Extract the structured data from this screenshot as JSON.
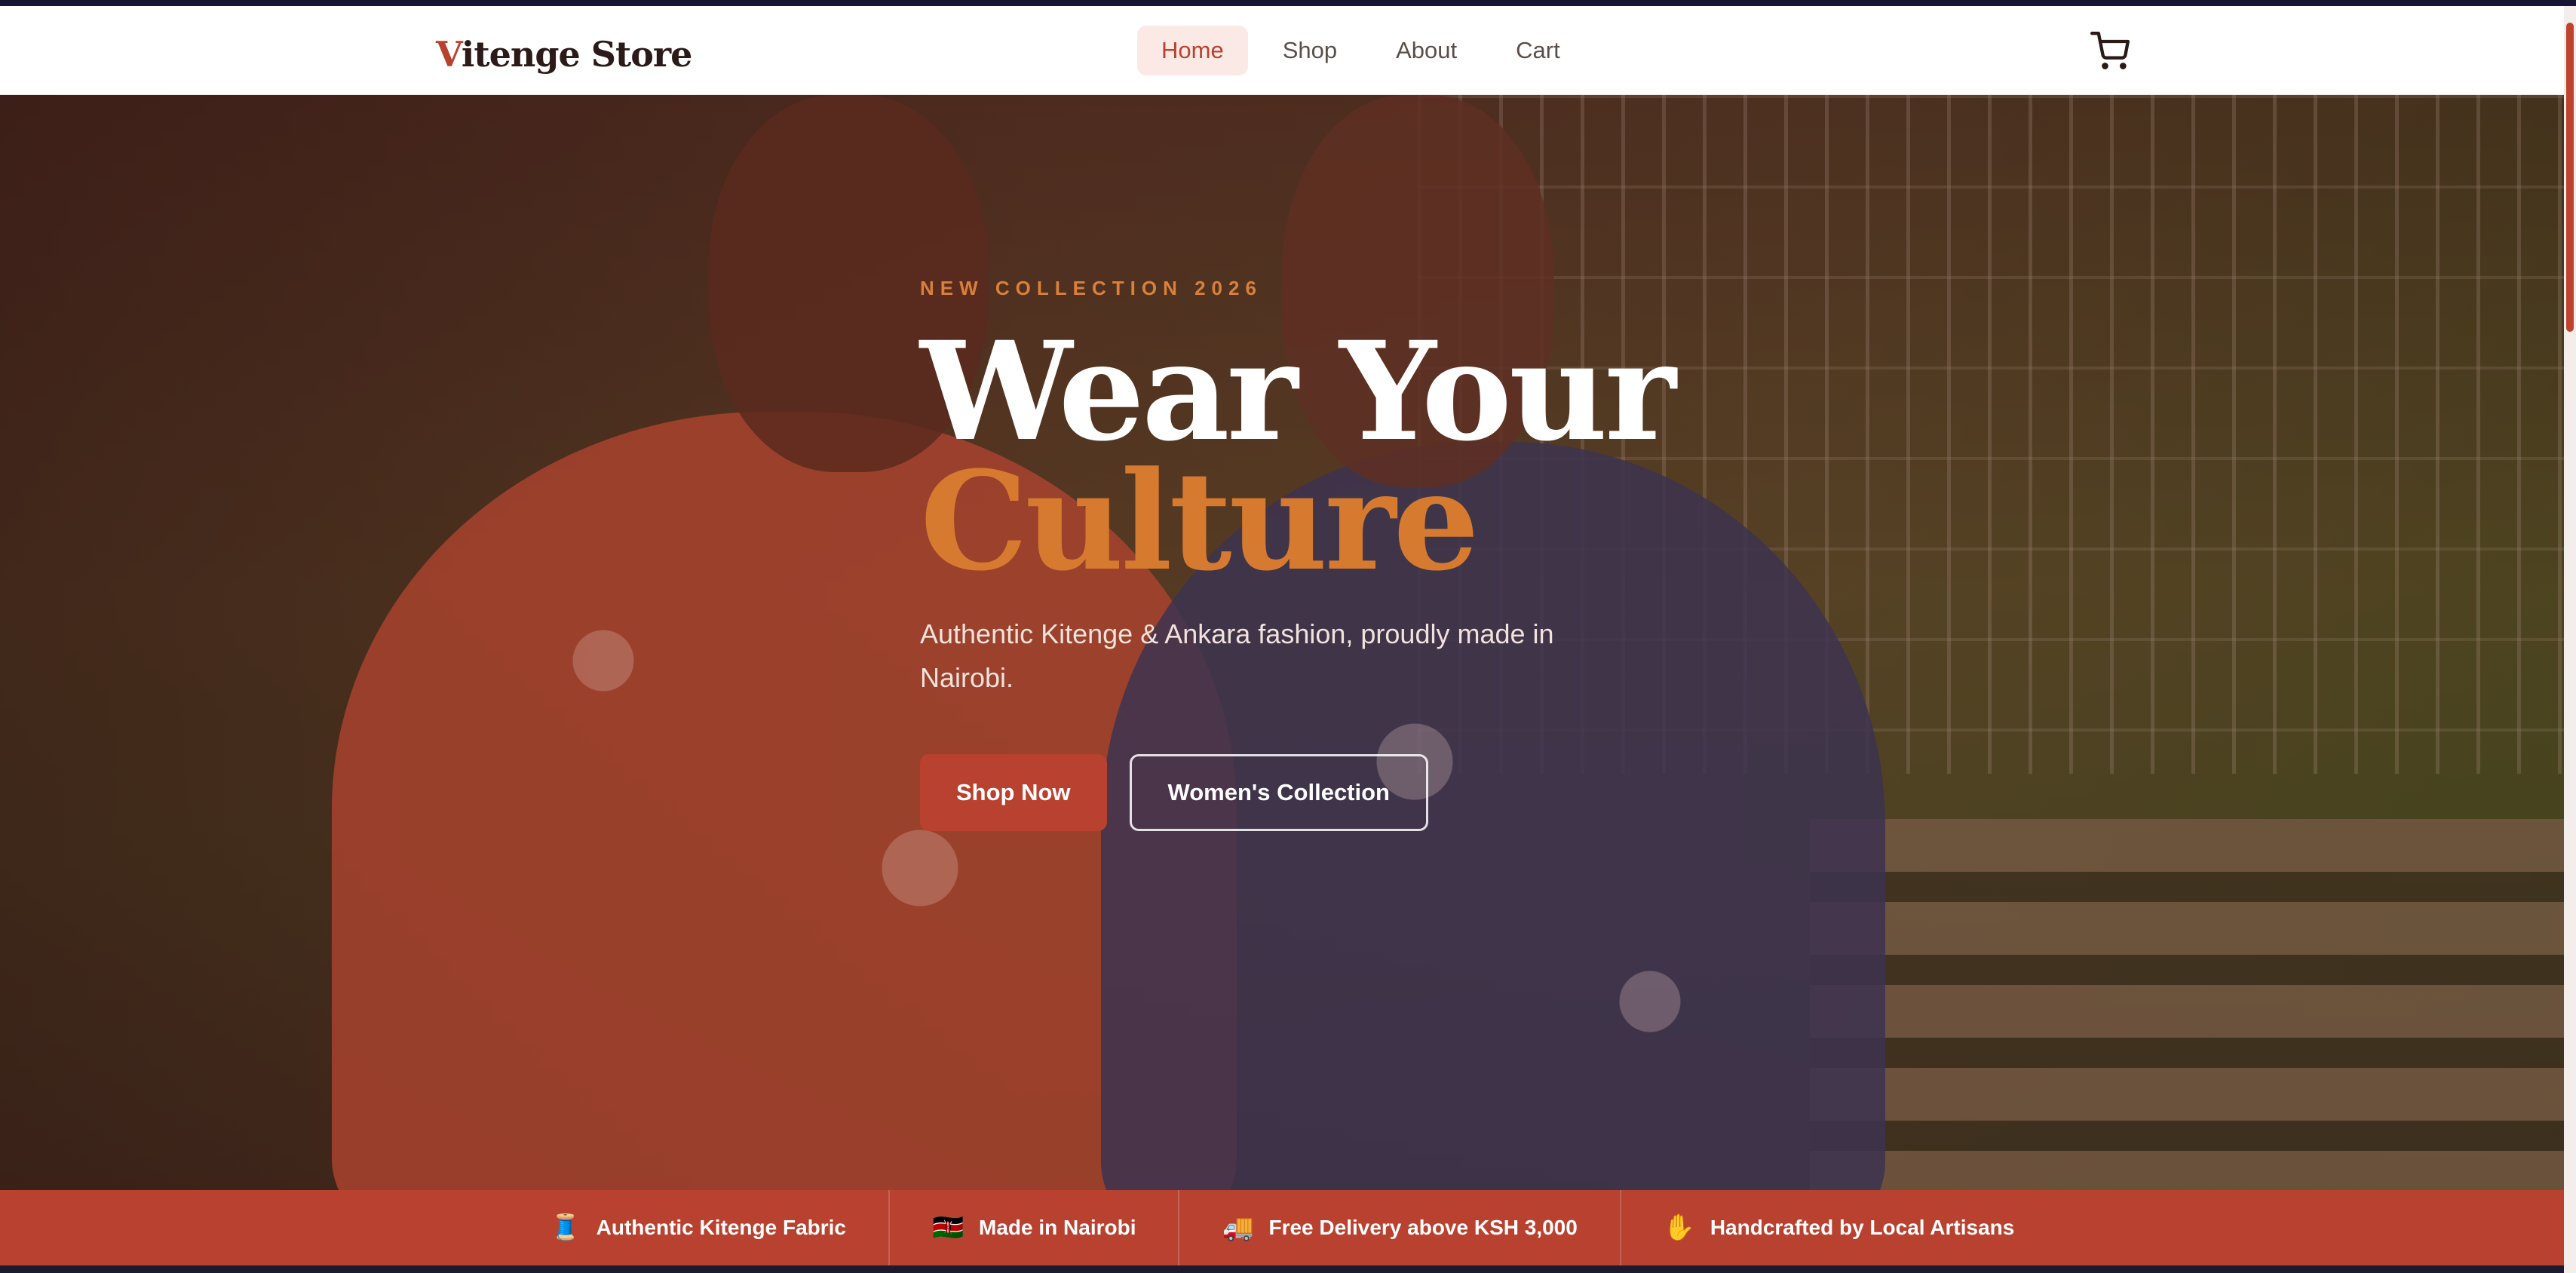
{
  "brand": {
    "initial": "V",
    "rest": "itenge Store"
  },
  "nav": {
    "items": [
      {
        "label": "Home",
        "active": true
      },
      {
        "label": "Shop",
        "active": false
      },
      {
        "label": "About",
        "active": false
      },
      {
        "label": "Cart",
        "active": false
      }
    ],
    "cart_icon": "cart-icon"
  },
  "hero": {
    "eyebrow": "NEW COLLECTION 2026",
    "headline_line1": "Wear Your",
    "headline_line2": "Culture",
    "subtitle": "Authentic Kitenge & Ankara fashion, proudly made in Nairobi.",
    "primary_cta": "Shop Now",
    "secondary_cta": "Women's Collection"
  },
  "features": [
    {
      "icon": "thread-spool-icon",
      "glyph": "🧵",
      "label": "Authentic Kitenge Fabric"
    },
    {
      "icon": "kenya-flag-icon",
      "glyph": "🇰🇪",
      "label": "Made in Nairobi"
    },
    {
      "icon": "delivery-truck-icon",
      "glyph": "🚚",
      "label": "Free Delivery above KSH 3,000"
    },
    {
      "icon": "hand-icon",
      "glyph": "✋",
      "label": "Handcrafted by Local Artisans"
    }
  ],
  "colors": {
    "accent": "#b8412f",
    "eyebrow": "#d9803a",
    "headline_accent": "#d57a2f",
    "nav_active_bg": "#fbe9e6"
  }
}
